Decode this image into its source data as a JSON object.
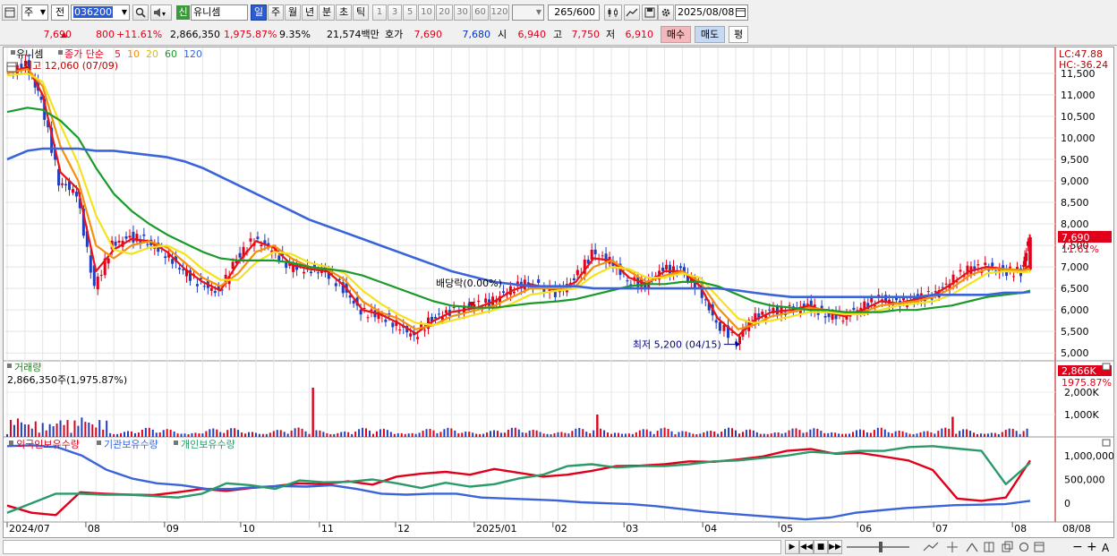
{
  "toolbar1": {
    "market_label": "주",
    "prev_label": "전",
    "stock_code": "036200",
    "new_badge": "신",
    "stock_name": "유니셈",
    "periods": [
      "일",
      "주",
      "월",
      "년",
      "분",
      "초",
      "틱"
    ],
    "active_period": "일",
    "intervals": [
      "1",
      "3",
      "5",
      "10",
      "20",
      "30",
      "60",
      "120"
    ],
    "count_value": "265",
    "count_total": "/600",
    "date_value": "2025/08/08"
  },
  "toolbar2": {
    "price": "7,690",
    "change": "800",
    "change_pct": "+11.61%",
    "volume": "2,866,350",
    "volume_pct": "1,975.87%",
    "turnover": "9.35%",
    "amount": "21,574백만",
    "quote_label": "호가",
    "ask": "7,690",
    "bid": "7,680",
    "open_label": "시",
    "open": "6,940",
    "high_label": "고",
    "high": "7,750",
    "low_label": "저",
    "low": "6,910",
    "buy_label": "매수",
    "sell_label": "매도",
    "eval_label": "평"
  },
  "colors": {
    "up": "#e0001a",
    "down": "#1f3fbf",
    "ma5": "#e8121a",
    "ma10": "#f5900a",
    "ma20": "#f4e31c",
    "ma60": "#1a9a2a",
    "ma120": "#3a64d8",
    "foreign": "#e0001a",
    "institution": "#3a64d8",
    "individual": "#2a9a6a"
  },
  "chart_data": [
    {
      "type": "candlestick",
      "legend": {
        "name": "유니셈",
        "ma_label": "종가 단순",
        "ma_periods": [
          "5",
          "10",
          "20",
          "60",
          "120"
        ]
      },
      "annotations": {
        "high_label": "최고 12,060 (07/09)",
        "low_label": "최저 5,200 (04/15)",
        "dividend_label": "배당락(0.00%)",
        "lc_label": "LC:47.88",
        "hc_label": "HC:-36.24",
        "current_price_tag": "7,690",
        "current_change_tag": "11.61%"
      },
      "x_ticks": [
        "2024/07",
        "08",
        "09",
        "10",
        "11",
        "12",
        "2025/01",
        "02",
        "03",
        "04",
        "05",
        "06",
        "07",
        "08",
        "08/08"
      ],
      "y_ticks": [
        "11,500",
        "11,000",
        "10,500",
        "10,000",
        "9,500",
        "9,000",
        "8,500",
        "8,000",
        "7,500",
        "7,000",
        "6,500",
        "6,000",
        "5,500",
        "5,000"
      ],
      "ylim": [
        4900,
        12060
      ],
      "close_series": [
        [
          "2024/07/01",
          11500
        ],
        [
          "2024/07/09",
          11700
        ],
        [
          "2024/07/15",
          10900
        ],
        [
          "2024/07/22",
          9000
        ],
        [
          "2024/07/29",
          8700
        ],
        [
          "2024/08/05",
          6500
        ],
        [
          "2024/08/12",
          7500
        ],
        [
          "2024/08/19",
          7700
        ],
        [
          "2024/08/26",
          7600
        ],
        [
          "2024/09/02",
          7300
        ],
        [
          "2024/09/09",
          6900
        ],
        [
          "2024/09/16",
          6600
        ],
        [
          "2024/09/23",
          6400
        ],
        [
          "2024/09/30",
          7200
        ],
        [
          "2024/10/07",
          7650
        ],
        [
          "2024/10/14",
          7400
        ],
        [
          "2024/10/21",
          7000
        ],
        [
          "2024/10/28",
          6950
        ],
        [
          "2024/11/04",
          6900
        ],
        [
          "2024/11/11",
          6500
        ],
        [
          "2024/11/18",
          5950
        ],
        [
          "2024/11/25",
          5900
        ],
        [
          "2024/12/02",
          5650
        ],
        [
          "2024/12/09",
          5400
        ],
        [
          "2024/12/16",
          5800
        ],
        [
          "2024/12/23",
          5950
        ],
        [
          "2025/01/02",
          6100
        ],
        [
          "2025/01/09",
          6200
        ],
        [
          "2025/01/16",
          6500
        ],
        [
          "2025/01/23",
          6650
        ],
        [
          "2025/02/03",
          6400
        ],
        [
          "2025/02/10",
          6700
        ],
        [
          "2025/02/17",
          7300
        ],
        [
          "2025/02/24",
          7150
        ],
        [
          "2025/03/03",
          6700
        ],
        [
          "2025/03/10",
          6600
        ],
        [
          "2025/03/17",
          6950
        ],
        [
          "2025/03/24",
          6900
        ],
        [
          "2025/03/31",
          6500
        ],
        [
          "2025/04/07",
          5700
        ],
        [
          "2025/04/15",
          5300
        ],
        [
          "2025/04/21",
          5800
        ],
        [
          "2025/04/28",
          5950
        ],
        [
          "2025/05/06",
          6000
        ],
        [
          "2025/05/13",
          6100
        ],
        [
          "2025/05/20",
          5900
        ],
        [
          "2025/05/27",
          5850
        ],
        [
          "2025/06/03",
          6050
        ],
        [
          "2025/06/10",
          6250
        ],
        [
          "2025/06/17",
          6150
        ],
        [
          "2025/06/24",
          6250
        ],
        [
          "2025/07/01",
          6350
        ],
        [
          "2025/07/08",
          6650
        ],
        [
          "2025/07/15",
          6950
        ],
        [
          "2025/07/22",
          7000
        ],
        [
          "2025/07/29",
          6900
        ],
        [
          "2025/08/05",
          6890
        ],
        [
          "2025/08/08",
          7690
        ]
      ],
      "series": [
        {
          "name": "5",
          "values": [
            11500,
            11650,
            11000,
            9200,
            8800,
            6900,
            7400,
            7650,
            7600,
            7350,
            6950,
            6650,
            6450,
            7100,
            7600,
            7450,
            7050,
            6950,
            6900,
            6550,
            6000,
            5900,
            5700,
            5450,
            5750,
            5950,
            6050,
            6200,
            6450,
            6600,
            6450,
            6650,
            7200,
            7150,
            6750,
            6600,
            6900,
            6900,
            6550,
            5800,
            5400,
            5750,
            5950,
            6000,
            6100,
            5950,
            5850,
            6000,
            6200,
            6150,
            6250,
            6350,
            6600,
            6900,
            7000,
            6950,
            6900,
            7050
          ]
        },
        {
          "name": "10",
          "values": [
            11500,
            11600,
            11200,
            9800,
            9000,
            7500,
            7200,
            7500,
            7600,
            7450,
            7100,
            6750,
            6550,
            6850,
            7350,
            7500,
            7200,
            7000,
            6950,
            6700,
            6200,
            5950,
            5800,
            5550,
            5650,
            5850,
            6000,
            6100,
            6300,
            6500,
            6500,
            6550,
            7000,
            7150,
            6900,
            6650,
            6800,
            6900,
            6650,
            6050,
            5550,
            5650,
            5850,
            5950,
            6050,
            6000,
            5900,
            5950,
            6100,
            6150,
            6200,
            6300,
            6500,
            6800,
            6950,
            6950,
            6920,
            6950
          ]
        },
        {
          "name": "20",
          "values": [
            11450,
            11500,
            11300,
            10300,
            9400,
            8200,
            7400,
            7300,
            7450,
            7500,
            7300,
            6950,
            6700,
            6700,
            7100,
            7350,
            7300,
            7100,
            7000,
            6850,
            6450,
            6150,
            5900,
            5700,
            5650,
            5750,
            5900,
            6000,
            6150,
            6350,
            6450,
            6500,
            6800,
            7000,
            6950,
            6750,
            6750,
            6850,
            6750,
            6300,
            5800,
            5700,
            5750,
            5850,
            5950,
            5950,
            5900,
            5900,
            6000,
            6100,
            6150,
            6200,
            6350,
            6600,
            6850,
            6900,
            6880,
            6890
          ]
        },
        {
          "name": "60",
          "values": [
            10600,
            10700,
            10650,
            10400,
            10000,
            9300,
            8700,
            8300,
            8000,
            7750,
            7550,
            7350,
            7200,
            7150,
            7150,
            7150,
            7100,
            7000,
            6950,
            6900,
            6800,
            6650,
            6500,
            6350,
            6200,
            6100,
            6050,
            6050,
            6100,
            6150,
            6200,
            6250,
            6350,
            6450,
            6550,
            6600,
            6600,
            6650,
            6650,
            6550,
            6350,
            6200,
            6100,
            6050,
            6000,
            6000,
            5950,
            5950,
            5950,
            6000,
            6000,
            6050,
            6100,
            6200,
            6300,
            6350,
            6400,
            6450
          ]
        },
        {
          "name": "120",
          "values": [
            9500,
            9700,
            9750,
            9750,
            9750,
            9700,
            9700,
            9650,
            9600,
            9550,
            9450,
            9300,
            9100,
            8900,
            8700,
            8500,
            8300,
            8100,
            7950,
            7800,
            7650,
            7500,
            7350,
            7200,
            7050,
            6900,
            6750,
            6650,
            6600,
            6550,
            6550,
            6550,
            6500,
            6500,
            6500,
            6500,
            6500,
            6500,
            6500,
            6500,
            6450,
            6400,
            6350,
            6300,
            6300,
            6300,
            6300,
            6300,
            6300,
            6300,
            6300,
            6350,
            6350,
            6350,
            6350,
            6400,
            6400,
            6420
          ]
        }
      ]
    },
    {
      "type": "bar",
      "legend": {
        "name": "거래량",
        "value": "2,866,350주(1,975.87%)"
      },
      "y_ticks": [
        "2,000K",
        "1,000K"
      ],
      "tags": {
        "value": "2,866K",
        "pct": "1975.87%"
      },
      "ylim": [
        0,
        3000000
      ],
      "spikes": [
        {
          "date": "2024/10/29",
          "value": 2200000
        },
        {
          "date": "2025/02/19",
          "value": 1000000
        },
        {
          "date": "2025/07/08",
          "value": 900000
        },
        {
          "date": "2025/08/08",
          "value": 2866350
        }
      ]
    },
    {
      "type": "line",
      "legend": [
        "외국인보유수량",
        "기관보유수량",
        "개인보유수량"
      ],
      "y_ticks": [
        "1,000,000",
        "500,000",
        "0"
      ],
      "ylim": [
        -300000,
        1300000
      ],
      "series": [
        {
          "name": "외국인보유수량",
          "values": [
            -50000,
            -200000,
            -250000,
            230000,
            200000,
            180000,
            170000,
            230000,
            300000,
            260000,
            320000,
            360000,
            420000,
            400000,
            460000,
            390000,
            560000,
            620000,
            660000,
            600000,
            720000,
            640000,
            560000,
            600000,
            680000,
            780000,
            790000,
            820000,
            880000,
            870000,
            920000,
            980000,
            1100000,
            1140000,
            1040000,
            1060000,
            980000,
            900000,
            700000,
            100000,
            50000,
            120000,
            900000
          ]
        },
        {
          "name": "기관보유수량",
          "values": [
            1200000,
            1220000,
            1180000,
            1000000,
            700000,
            520000,
            420000,
            380000,
            300000,
            300000,
            340000,
            360000,
            350000,
            380000,
            300000,
            200000,
            180000,
            200000,
            200000,
            120000,
            100000,
            80000,
            60000,
            20000,
            0,
            -20000,
            -60000,
            -120000,
            -180000,
            -220000,
            -260000,
            -300000,
            -340000,
            -300000,
            -200000,
            -150000,
            -100000,
            -70000,
            -40000,
            -30000,
            -20000,
            50000
          ]
        },
        {
          "name": "개인보유수량",
          "values": [
            -200000,
            0,
            200000,
            200000,
            180000,
            180000,
            150000,
            120000,
            200000,
            420000,
            380000,
            300000,
            480000,
            440000,
            450000,
            500000,
            420000,
            320000,
            430000,
            350000,
            400000,
            520000,
            600000,
            780000,
            820000,
            750000,
            780000,
            780000,
            820000,
            880000,
            900000,
            950000,
            1000000,
            1080000,
            1050000,
            1100000,
            1100000,
            1180000,
            1200000,
            1150000,
            1100000,
            400000,
            850000
          ]
        }
      ]
    }
  ],
  "footer": {
    "zoom_out": "−",
    "zoom_in": "+",
    "auto_label": "A"
  }
}
